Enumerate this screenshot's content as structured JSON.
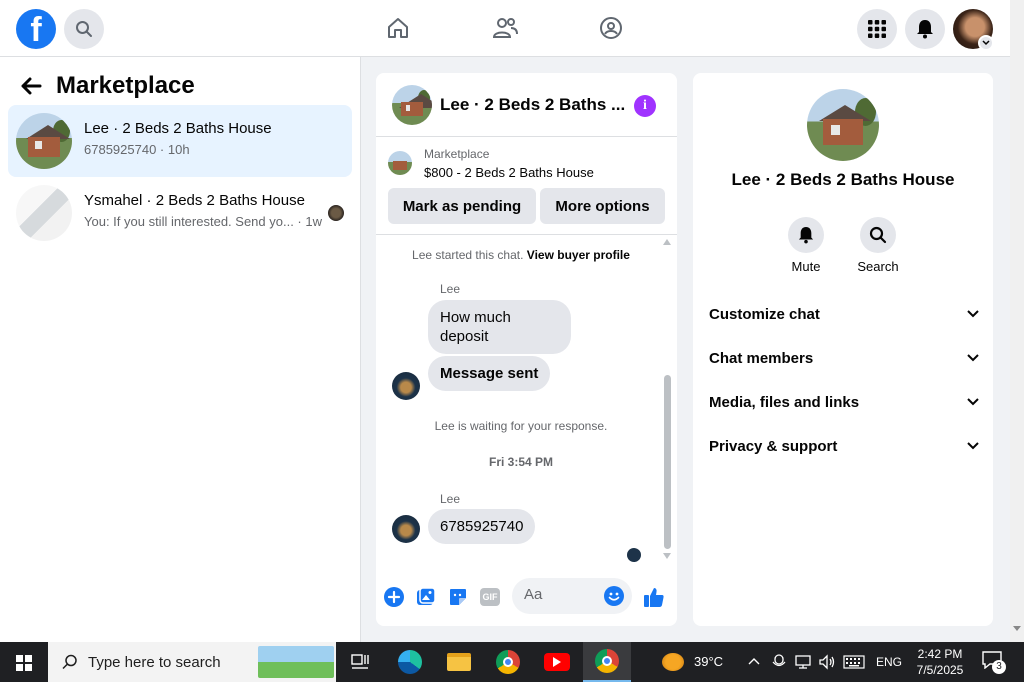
{
  "topnav": {
    "logo": "f",
    "icons": [
      "search-icon",
      "home-icon",
      "friends-icon",
      "groups-icon",
      "menu-grid-icon",
      "bell-icon"
    ]
  },
  "left": {
    "title": "Marketplace",
    "conversations": [
      {
        "name": "Lee · 2 Beds 2 Baths House",
        "sub": "6785925740 · 10h",
        "active": true
      },
      {
        "name": "Ysmahel · 2 Beds 2 Baths House",
        "sub": "You: If you still interested. Send yo... · 1w",
        "active": false
      }
    ]
  },
  "chat": {
    "title": "Lee · 2 Beds 2 Baths ...",
    "marketplace_label": "Marketplace",
    "listing": "$800 - 2 Beds 2 Baths House",
    "mark_pending": "Mark as pending",
    "more_options": "More options",
    "started_prefix": "Lee started this chat.",
    "view_buyer": "View buyer profile",
    "sender1": "Lee",
    "msg1": "How much deposit",
    "msg2": "Message sent",
    "waiting": "Lee is waiting for your response.",
    "timestamp": "Fri 3:54 PM",
    "sender2": "Lee",
    "msg3": "6785925740",
    "composer_placeholder": "Aa",
    "gif_label": "GIF"
  },
  "info": {
    "name": "Lee · 2 Beds 2 Baths House",
    "mute": "Mute",
    "search": "Search",
    "sections": [
      "Customize chat",
      "Chat members",
      "Media, files and links",
      "Privacy & support"
    ]
  },
  "taskbar": {
    "search_placeholder": "Type here to search",
    "weather": "39°C",
    "lang": "ENG",
    "time": "2:42 PM",
    "date": "7/5/2025",
    "notifications": "3"
  },
  "colors": {
    "brand": "#1877f2",
    "info": "#a033ff",
    "active_row": "#e7f3ff"
  }
}
